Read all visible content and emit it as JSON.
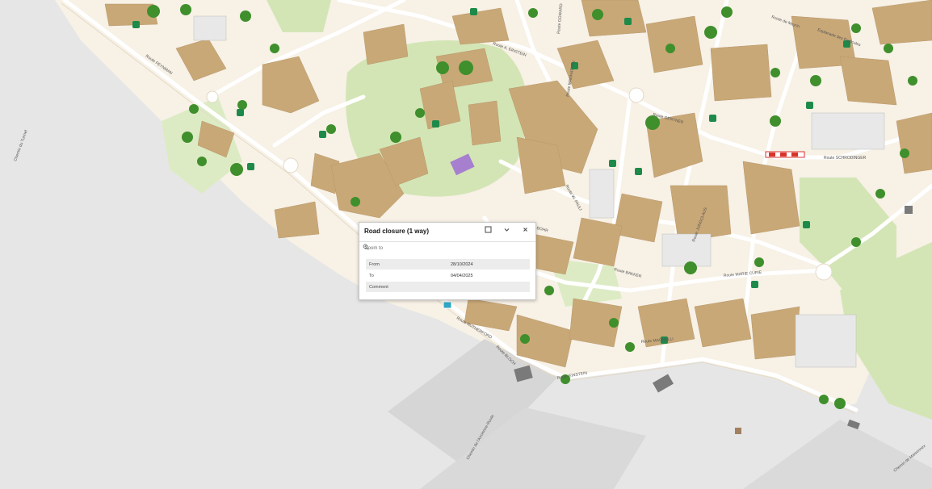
{
  "map": {
    "labels": {
      "street_1": "Route FEYNMAN",
      "street_2": "Route RUTHERFORD",
      "street_3": "Route EINSTEIN",
      "street_4": "Route BOHR",
      "street_5": "Route SCHRODINGER",
      "street_6": "Route BAKKER",
      "street_7": "Route MARIE CURIE",
      "street_8": "Route BLOCH",
      "street_9": "Route MAGNELLI",
      "street_10": "Route GENTNER",
      "street_11": "Route GOWARD",
      "street_12": "Route JUNGCLAUS",
      "street_13": "Route MANHATTAN",
      "street_14": "Route A. EINSTEIN",
      "street_15": "Esplanade des Particules",
      "street_16": "Chemin de Maisonnex",
      "street_17": "Chemin du Tunnel",
      "street_18": "Chemin de l'Ancienne-Route",
      "street_19": "Route de Meyrin",
      "street_20": "Route W. PAULI"
    },
    "colors": {
      "background": "#e6e6e6",
      "campus": "#f7f1e6",
      "green": "#cfe3b0",
      "building": "#c9a877",
      "road": "#ffffff",
      "tree": "#3f8f2c",
      "parking_icon": "#1e8a4a",
      "closure": "#d8342c"
    }
  },
  "popup": {
    "title": "Road closure (1 way)",
    "zoom_label": "Zoom to",
    "icons": {
      "dock": "dock-square-icon",
      "collapse": "chevron-down-icon",
      "close": "close-icon",
      "zoom": "magnifier-icon"
    },
    "attributes": [
      {
        "field": "From",
        "value": "28/10/2024"
      },
      {
        "field": "To",
        "value": "04/04/2025"
      },
      {
        "field": "Comment",
        "value": ""
      }
    ]
  }
}
